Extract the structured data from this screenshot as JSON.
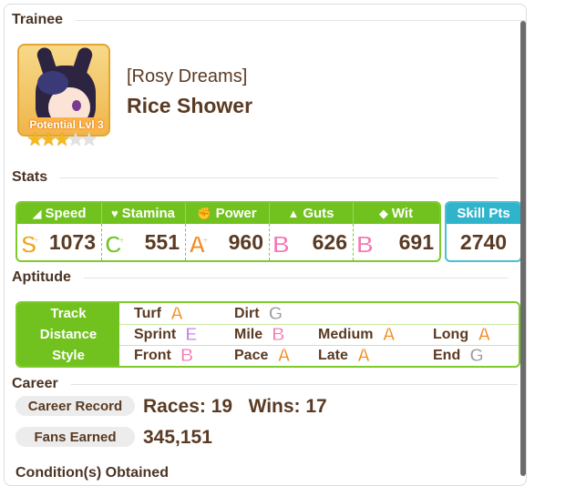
{
  "trainee": {
    "section": "Trainee",
    "epithet": "[Rosy Dreams]",
    "name": "Rice Shower",
    "potential": "Potential Lvl 3",
    "stars_filled": 3,
    "stars_total": 5
  },
  "stats": {
    "section": "Stats",
    "items": [
      {
        "label": "Speed",
        "icon": "shoe-icon",
        "glyph": "◢",
        "grade": "S",
        "plus": "+",
        "value": "1073"
      },
      {
        "label": "Stamina",
        "icon": "heart-icon",
        "glyph": "♥",
        "grade": "C",
        "plus": "+",
        "value": "551"
      },
      {
        "label": "Power",
        "icon": "arm-icon",
        "glyph": "✊",
        "grade": "A",
        "plus": "+",
        "value": "960"
      },
      {
        "label": "Guts",
        "icon": "flame-icon",
        "glyph": "▲",
        "grade": "B",
        "plus": "",
        "value": "626"
      },
      {
        "label": "Wit",
        "icon": "grad-cap-icon",
        "glyph": "◆",
        "grade": "B",
        "plus": "",
        "value": "691"
      }
    ],
    "skill_pts_label": "Skill Pts",
    "skill_pts": "2740"
  },
  "aptitude": {
    "section": "Aptitude",
    "rows": [
      {
        "label": "Track",
        "cells": [
          {
            "name": "Turf",
            "grade": "A"
          },
          {
            "name": "Dirt",
            "grade": "G"
          }
        ]
      },
      {
        "label": "Distance",
        "cells": [
          {
            "name": "Sprint",
            "grade": "E"
          },
          {
            "name": "Mile",
            "grade": "B"
          },
          {
            "name": "Medium",
            "grade": "A"
          },
          {
            "name": "Long",
            "grade": "A"
          }
        ]
      },
      {
        "label": "Style",
        "cells": [
          {
            "name": "Front",
            "grade": "B"
          },
          {
            "name": "Pace",
            "grade": "A"
          },
          {
            "name": "Late",
            "grade": "A"
          },
          {
            "name": "End",
            "grade": "G"
          }
        ]
      }
    ]
  },
  "career": {
    "section": "Career",
    "record_label": "Career Record",
    "record_value": "Races: 19   Wins: 17",
    "fans_label": "Fans Earned",
    "fans_value": "345,151",
    "next_section_partial": "Condition(s) Obtained"
  },
  "colors": {
    "green": "#72c21f",
    "teal": "#2fb4cb",
    "text_brown": "#5a3a22"
  }
}
